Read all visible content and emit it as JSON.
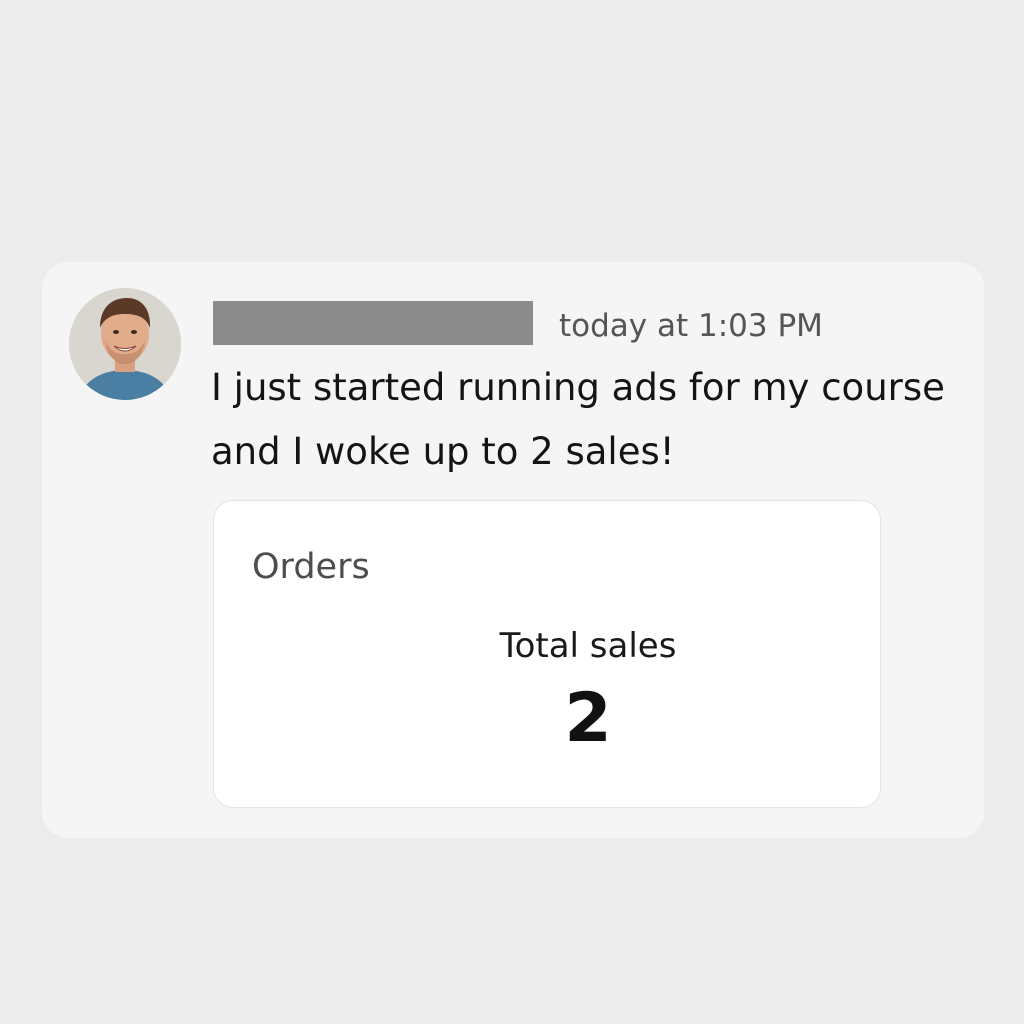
{
  "message": {
    "author_redacted": true,
    "timestamp": "today at 1:03 PM",
    "body_line1": "I just started running ads for my course",
    "body_line2": "and I woke up to 2 sales!"
  },
  "orders_card": {
    "title": "Orders",
    "metric_label": "Total sales",
    "metric_value": "2"
  },
  "colors": {
    "page_background": "#ececec",
    "message_background": "#f5f5f5",
    "card_background": "#ffffff",
    "redaction_bar": "#8c8c8c",
    "timestamp_text": "#555555"
  },
  "icons": {
    "avatar": "user-avatar-photo"
  }
}
